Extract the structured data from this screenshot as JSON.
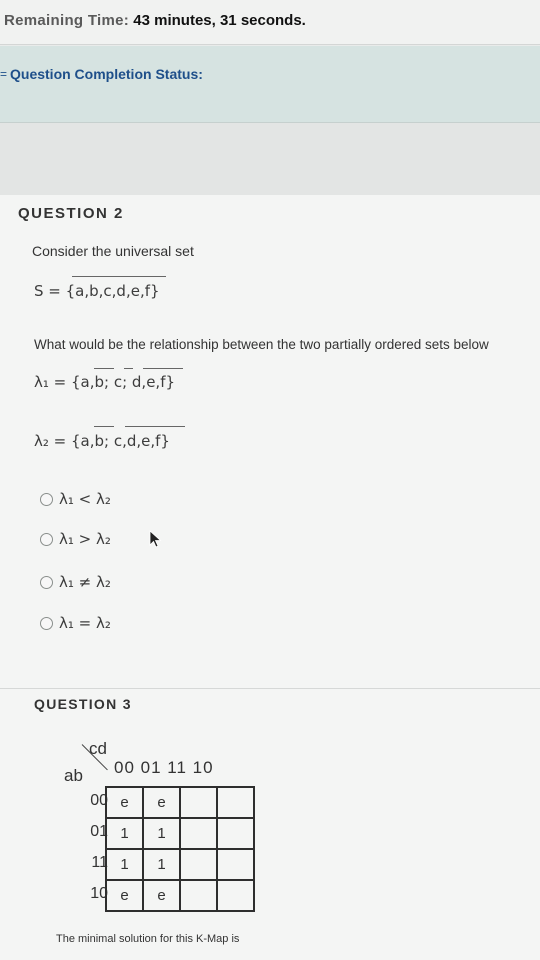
{
  "timer": {
    "label": "Remaining Time:",
    "value": "43 minutes, 31 seconds."
  },
  "status": {
    "label": "Question Completion Status:"
  },
  "question2": {
    "title": "QUESTION 2",
    "prompt": "Consider the universal set",
    "set_s": "S = {a,b,c,d,e,f}",
    "relationship_prompt": "What would be the relationship between the two partially ordered sets below",
    "lambda1": "λ₁ = {a,b; c; d,e,f}",
    "lambda2": "λ₂ = {a,b; c,d,e,f}",
    "options": [
      "λ₁ < λ₂",
      "λ₁ > λ₂",
      "λ₁ ≠ λ₂",
      "λ₁ = λ₂"
    ]
  },
  "question3": {
    "title": "QUESTION 3",
    "kmap": {
      "cd_label": "cd",
      "ab_label": "ab",
      "col_headers": "00 01 11 10",
      "row_headers": [
        "00",
        "01",
        "11",
        "10"
      ],
      "cells": [
        [
          "e",
          "e",
          "",
          ""
        ],
        [
          "1",
          "1",
          "",
          ""
        ],
        [
          "1",
          "1",
          "",
          ""
        ],
        [
          "e",
          "e",
          "",
          ""
        ]
      ]
    },
    "prompt": "The minimal solution for this K-Map is"
  }
}
